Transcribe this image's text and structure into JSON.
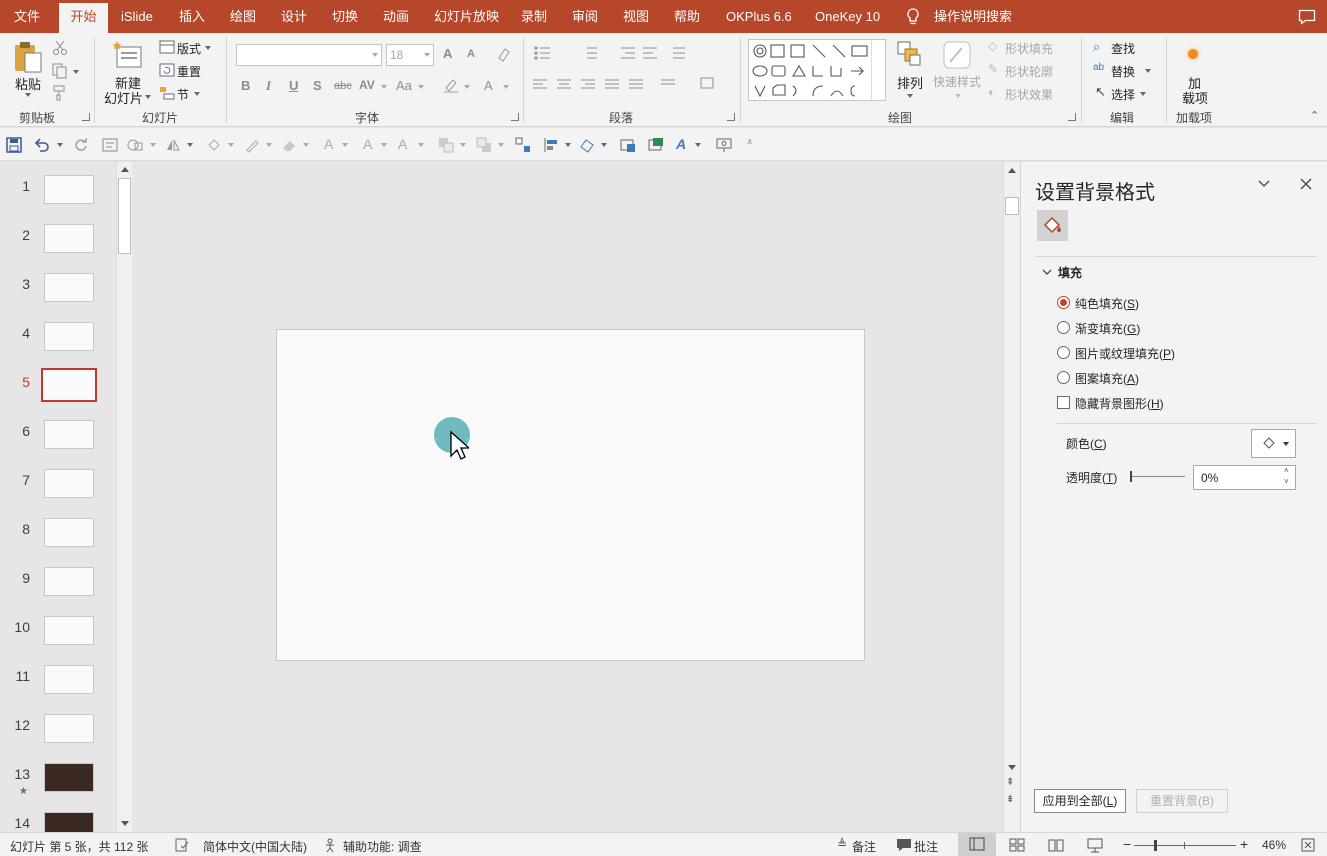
{
  "menu": {
    "tabs": [
      {
        "label": "文件"
      },
      {
        "label": "开始"
      },
      {
        "label": "iSlide"
      },
      {
        "label": "插入"
      },
      {
        "label": "绘图"
      },
      {
        "label": "设计"
      },
      {
        "label": "切换"
      },
      {
        "label": "动画"
      },
      {
        "label": "幻灯片放映"
      },
      {
        "label": "录制"
      },
      {
        "label": "审阅"
      },
      {
        "label": "视图"
      },
      {
        "label": "帮助"
      },
      {
        "label": "OKPlus 6.6"
      },
      {
        "label": "OneKey 10"
      }
    ],
    "active_tab": "开始",
    "tell_me": "操作说明搜索",
    "accent": "#b7472a"
  },
  "ribbon": {
    "clipboard": {
      "paste": "粘贴",
      "group": "剪贴板"
    },
    "slides": {
      "new_slide_1": "新建",
      "new_slide_2": "幻灯片",
      "layout": "版式",
      "reset": "重置",
      "section": "节",
      "group": "幻灯片"
    },
    "font": {
      "font_name": "",
      "font_size": "18",
      "bold": "B",
      "italic": "I",
      "underline": "U",
      "shadow": "S",
      "strike": "abc",
      "spacing": "AV",
      "case": "Aa",
      "grow": "A",
      "shrink": "A",
      "color": "A",
      "group": "字体"
    },
    "paragraph": {
      "group": "段落"
    },
    "drawing": {
      "arrange": "排列",
      "quick_styles": "快速样式",
      "shape_fill": "形状填充",
      "shape_outline": "形状轮廓",
      "shape_effects": "形状效果",
      "group": "绘图"
    },
    "editing": {
      "find": "查找",
      "replace": "替换",
      "select": "选择",
      "group": "编辑"
    },
    "addins": {
      "label_1": "加",
      "label_2": "载项",
      "group": "加载项"
    }
  },
  "thumbnails": {
    "current": 5,
    "items": [
      {
        "num": "1",
        "dark": false,
        "star": false
      },
      {
        "num": "2",
        "dark": false,
        "star": false
      },
      {
        "num": "3",
        "dark": false,
        "star": false
      },
      {
        "num": "4",
        "dark": false,
        "star": false
      },
      {
        "num": "5",
        "dark": false,
        "star": false
      },
      {
        "num": "6",
        "dark": false,
        "star": false
      },
      {
        "num": "7",
        "dark": false,
        "star": false
      },
      {
        "num": "8",
        "dark": false,
        "star": false
      },
      {
        "num": "9",
        "dark": false,
        "star": false
      },
      {
        "num": "10",
        "dark": false,
        "star": false
      },
      {
        "num": "11",
        "dark": false,
        "star": false
      },
      {
        "num": "12",
        "dark": false,
        "star": false
      },
      {
        "num": "13",
        "dark": true,
        "star": true
      },
      {
        "num": "14",
        "dark": true,
        "star": false
      }
    ],
    "star_glyph": "★"
  },
  "format_pane": {
    "title": "设置背景格式",
    "section": "填充",
    "options": [
      {
        "text": "纯色填充(",
        "key": "S",
        "checked": true
      },
      {
        "text": "渐变填充(",
        "key": "G",
        "checked": false
      },
      {
        "text": "图片或纹理填充(",
        "key": "P",
        "checked": false
      },
      {
        "text": "图案填充(",
        "key": "A",
        "checked": false
      }
    ],
    "hide_bg": {
      "text": "隐藏背景图形(",
      "key": "H"
    },
    "color": {
      "text": "颜色(",
      "key": "C"
    },
    "transparency": {
      "text": "透明度(",
      "key": "T",
      "value": "0%"
    },
    "apply_all": {
      "text": "应用到全部(",
      "key": "L"
    },
    "reset_bg": "重置背景(B)",
    "close_paren": ")"
  },
  "statusbar": {
    "slide_info": "幻灯片 第 5 张，共 112 张",
    "language": "简体中文(中国大陆)",
    "accessibility": "辅助功能: 调查",
    "notes": "备注",
    "comments": "批注",
    "zoom": "46%",
    "zoom_level": 0.46
  }
}
